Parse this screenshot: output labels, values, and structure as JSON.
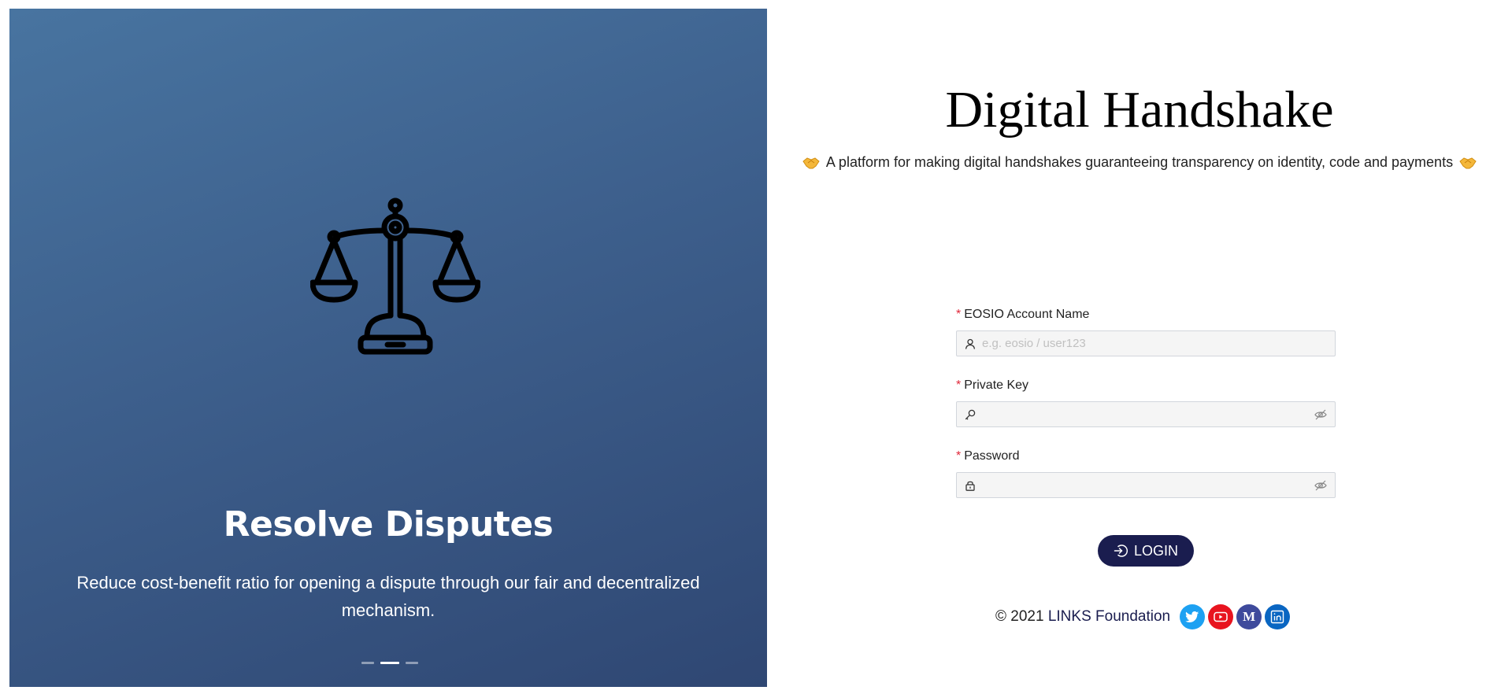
{
  "carousel": {
    "title": "Resolve Disputes",
    "description": "Reduce cost-benefit ratio for opening a dispute through our fair and decentralized mechanism.",
    "slide_count": 3,
    "active_slide": 2,
    "icon": "scales-icon"
  },
  "brand": {
    "title": "Digital Handshake",
    "subtitle": "A platform for making digital handshakes guaranteeing transparency on identity, code and payments",
    "subtitle_icon": "handshake-icon"
  },
  "form": {
    "account": {
      "label": "EOSIO Account Name",
      "placeholder": "e.g. eosio / user123",
      "value": "",
      "icon": "user-icon"
    },
    "private_key": {
      "label": "Private Key",
      "value": "",
      "icon": "key-icon"
    },
    "password": {
      "label": "Password",
      "value": "",
      "icon": "lock-icon"
    },
    "required_marker": "*",
    "login_label": "LOGIN"
  },
  "footer": {
    "copyright": "© 2021",
    "org": "LINKS Foundation",
    "socials": [
      {
        "name": "twitter",
        "color": "#1da1f2"
      },
      {
        "name": "youtube",
        "color": "#e8141f"
      },
      {
        "name": "medium",
        "color": "#3e4a9c",
        "glyph": "M"
      },
      {
        "name": "linkedin",
        "color": "#0a66c2"
      }
    ]
  },
  "colors": {
    "accent": "#1a1d4f",
    "required": "#e0283a",
    "hero_gradient_start": "#4874a0",
    "hero_gradient_end": "#2f4773"
  }
}
